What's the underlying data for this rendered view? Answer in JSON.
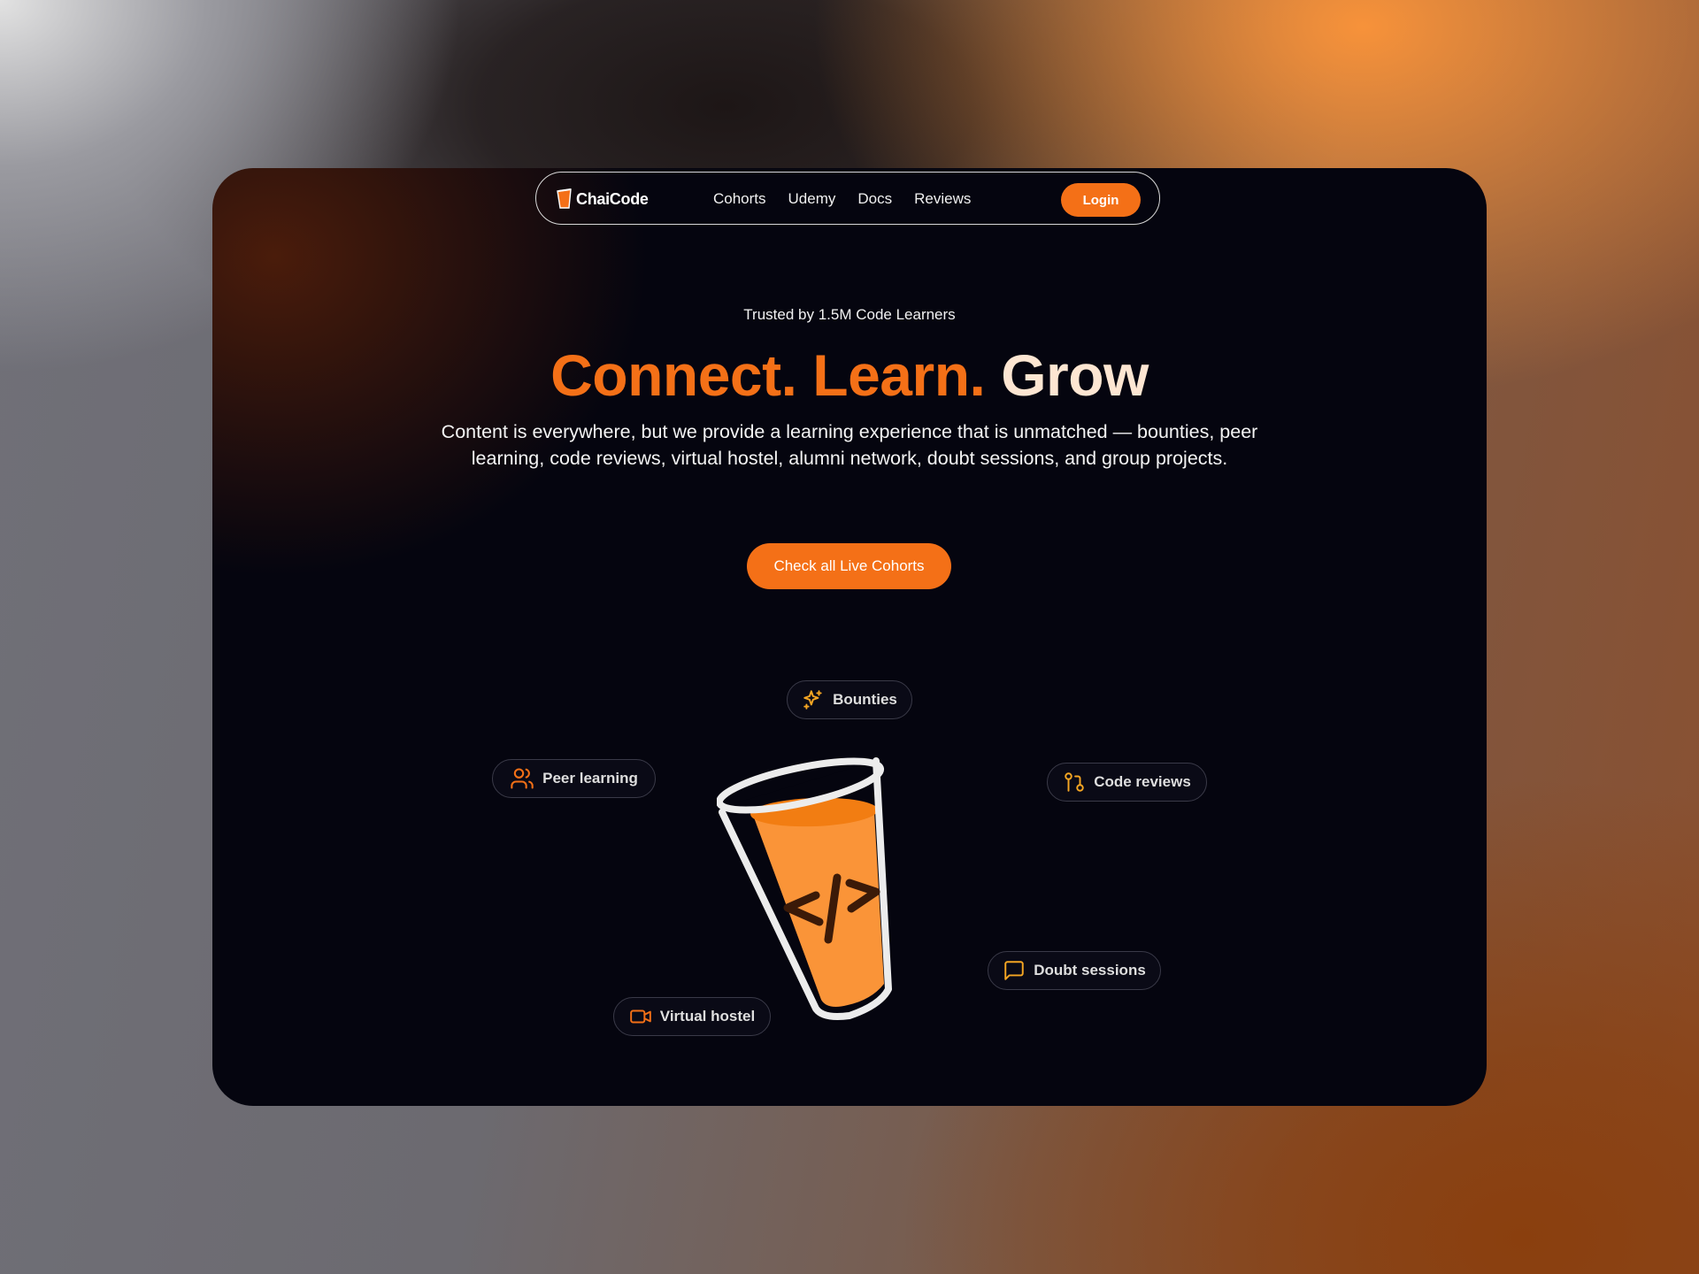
{
  "nav": {
    "brand": "ChaiCode",
    "links": [
      "Cohorts",
      "Udemy",
      "Docs",
      "Reviews"
    ],
    "login_label": "Login"
  },
  "hero": {
    "trusted": "Trusted by 1.5M Code Learners",
    "headline_words": [
      "Connect.",
      "Learn.",
      "Grow"
    ],
    "description": "Content is everywhere, but we provide a learning experience that is unmatched — bounties, peer learning, code reviews, virtual hostel, alumni network, doubt sessions, and group projects.",
    "cta_label": "Check all Live Cohorts"
  },
  "features": {
    "bounties": {
      "label": "Bounties",
      "icon": "sparkles-icon"
    },
    "peer_learning": {
      "label": "Peer learning",
      "icon": "users-icon"
    },
    "code_reviews": {
      "label": "Code reviews",
      "icon": "git-pull-request-icon"
    },
    "doubt_sessions": {
      "label": "Doubt sessions",
      "icon": "message-square-icon"
    },
    "virtual_hostel": {
      "label": "Virtual hostel",
      "icon": "video-camera-icon"
    }
  },
  "illustration": {
    "cup_code": "</>",
    "icon": "chai-cup-code-icon"
  },
  "colors": {
    "accent": "#f47017",
    "background": "#05050f",
    "headline_light": "#fde6d2",
    "icon_amber": "#f5a623"
  }
}
